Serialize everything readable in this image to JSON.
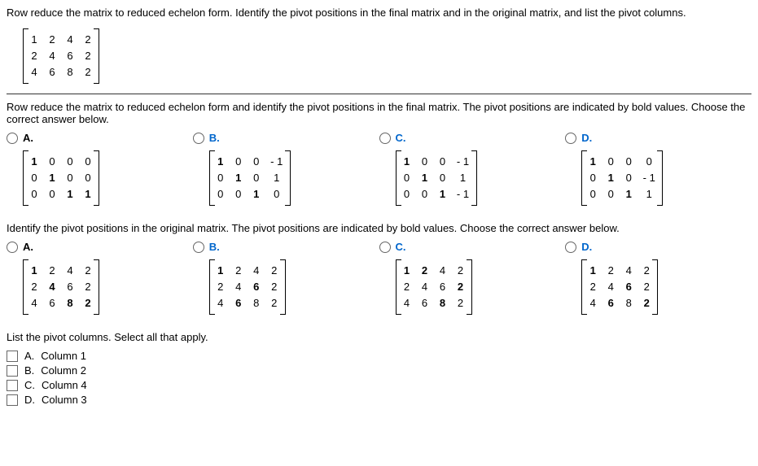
{
  "q1_text": "Row reduce the matrix to reduced echelon form. Identify the pivot positions in the final matrix and in the original matrix, and list the pivot columns.",
  "main_matrix": [
    [
      "1",
      "2",
      "4",
      "2"
    ],
    [
      "2",
      "4",
      "6",
      "2"
    ],
    [
      "4",
      "6",
      "8",
      "2"
    ]
  ],
  "q2_text": "Row reduce the matrix to reduced echelon form and identify the pivot positions in the final matrix. The pivot positions are indicated by bold values. Choose the correct answer below.",
  "opts1": {
    "A": {
      "label": "A.",
      "matrix": [
        [
          "1",
          "0",
          "0",
          "0"
        ],
        [
          "0",
          "1",
          "0",
          "0"
        ],
        [
          "0",
          "0",
          "1",
          "1"
        ]
      ]
    },
    "B": {
      "label": "B.",
      "matrix": [
        [
          "1",
          "0",
          "0",
          "- 1"
        ],
        [
          "0",
          "1",
          "0",
          "1"
        ],
        [
          "0",
          "0",
          "1",
          "0"
        ]
      ]
    },
    "C": {
      "label": "C.",
      "matrix": [
        [
          "1",
          "0",
          "0",
          "- 1"
        ],
        [
          "0",
          "1",
          "0",
          "1"
        ],
        [
          "0",
          "0",
          "1",
          "- 1"
        ]
      ]
    },
    "D": {
      "label": "D.",
      "matrix": [
        [
          "1",
          "0",
          "0",
          "0"
        ],
        [
          "0",
          "1",
          "0",
          "- 1"
        ],
        [
          "0",
          "0",
          "1",
          "1"
        ]
      ]
    }
  },
  "q3_text": "Identify the pivot positions in the original matrix. The pivot positions are indicated by bold values. Choose the correct answer below.",
  "opts2": {
    "A": {
      "label": "A.",
      "matrix": [
        [
          "1",
          "2",
          "4",
          "2"
        ],
        [
          "2",
          "4",
          "6",
          "2"
        ],
        [
          "4",
          "6",
          "8",
          "2"
        ]
      ]
    },
    "B": {
      "label": "B.",
      "matrix": [
        [
          "1",
          "2",
          "4",
          "2"
        ],
        [
          "2",
          "4",
          "6",
          "2"
        ],
        [
          "4",
          "6",
          "8",
          "2"
        ]
      ]
    },
    "C": {
      "label": "C.",
      "matrix": [
        [
          "1",
          "2",
          "4",
          "2"
        ],
        [
          "2",
          "4",
          "6",
          "2"
        ],
        [
          "4",
          "6",
          "8",
          "2"
        ]
      ]
    },
    "D": {
      "label": "D.",
      "matrix": [
        [
          "1",
          "2",
          "4",
          "2"
        ],
        [
          "2",
          "4",
          "6",
          "2"
        ],
        [
          "4",
          "6",
          "8",
          "2"
        ]
      ]
    }
  },
  "q4_text": "List the pivot columns. Select all that apply.",
  "checkboxes": {
    "A": {
      "prefix": "A.",
      "label": "Column 1"
    },
    "B": {
      "prefix": "B.",
      "label": "Column 2"
    },
    "C": {
      "prefix": "C.",
      "label": "Column 4"
    },
    "D": {
      "prefix": "D.",
      "label": "Column 3"
    }
  }
}
